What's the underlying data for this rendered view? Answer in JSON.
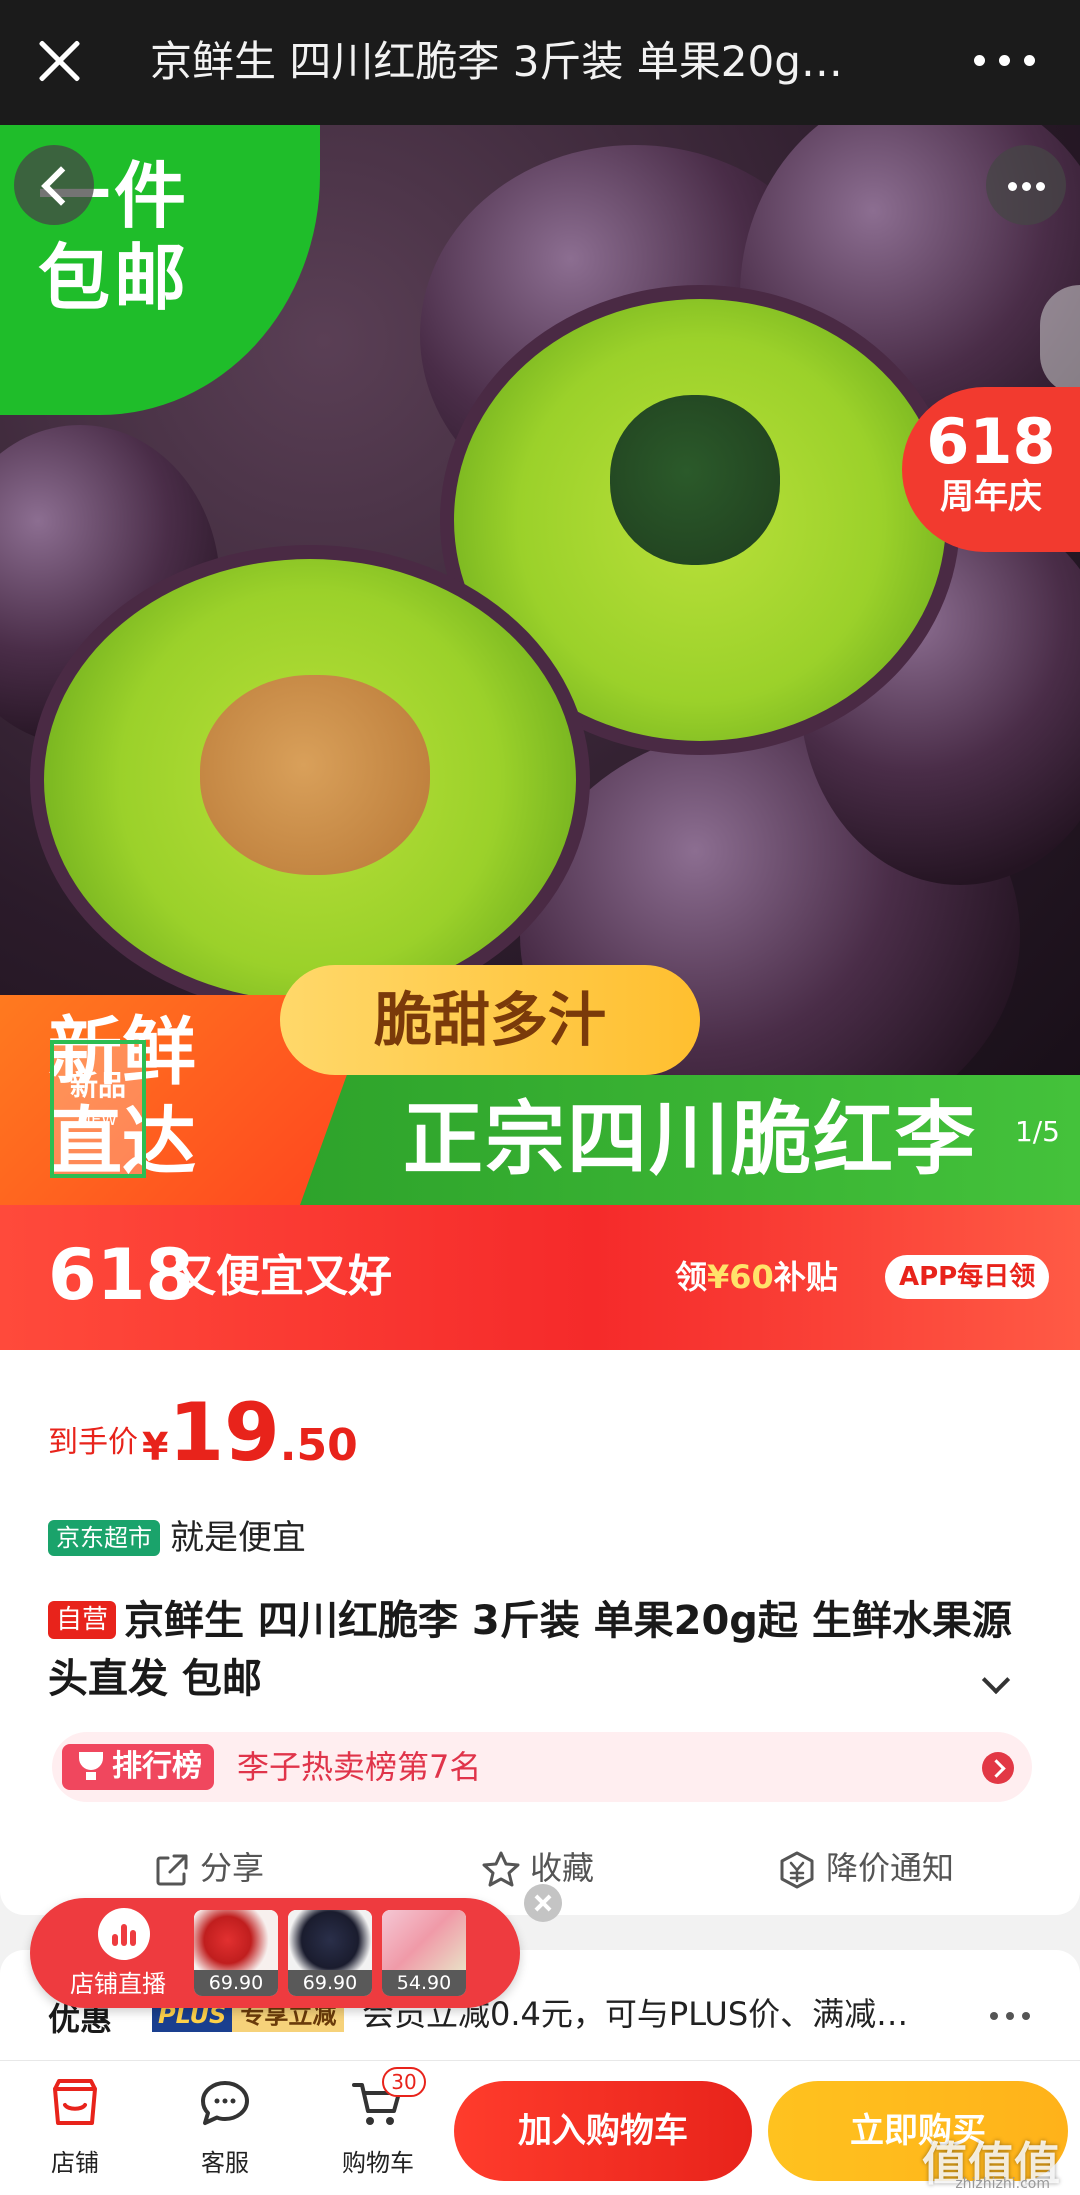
{
  "topbar": {
    "title": "京鲜生 四川红脆李 3斤装 单果20g…"
  },
  "hero": {
    "badge_left": "一件\n包邮",
    "badge_618_num": "618",
    "badge_618_label": "周年庆",
    "orange_text": "新鲜\n直达",
    "pill_text": "脆甜多汁",
    "green_text": "正宗四川脆红李",
    "new_tag_cn": "新品",
    "new_tag_en": "NEW",
    "pager": "1/5"
  },
  "promo": {
    "num": "618",
    "slogan": "又便宜又好",
    "sub_prefix": "领",
    "sub_amount": "¥60",
    "sub_suffix": "补贴",
    "app_tag": "APP每日领"
  },
  "price": {
    "label": "到手价",
    "currency": "¥",
    "integer": "19",
    "decimal": ".50"
  },
  "market": {
    "tag": "京东超市",
    "text": "就是便宜"
  },
  "product": {
    "self_tag": "自营",
    "title": "京鲜生 四川红脆李 3斤装 单果20g起 生鲜水果源头直发 包邮"
  },
  "rank": {
    "tag": "排行榜",
    "text": "李子热卖榜第7名"
  },
  "actions": {
    "share": "分享",
    "favorite": "收藏",
    "price_alert": "降价通知"
  },
  "live": {
    "label": "店铺直播",
    "items": [
      {
        "price": "69.90"
      },
      {
        "price": "69.90"
      },
      {
        "price": "54.90"
      }
    ]
  },
  "discount": {
    "label": "优惠",
    "plus_tag": "PLUS",
    "plus_sub": "专享立减",
    "text": "会员立减0.4元，可与PLUS价、满减…"
  },
  "bottombar": {
    "shop": "店铺",
    "service": "客服",
    "cart": "购物车",
    "cart_count": "30",
    "add_to_cart": "加入购物车",
    "buy_now": "立即购买"
  },
  "watermark": {
    "main": "值值值",
    "sub": "zhizhizhi.com"
  },
  "colors": {
    "accent_red": "#e8231b",
    "buy_yellow": "#ffc21f",
    "market_green": "#1aa36b"
  }
}
